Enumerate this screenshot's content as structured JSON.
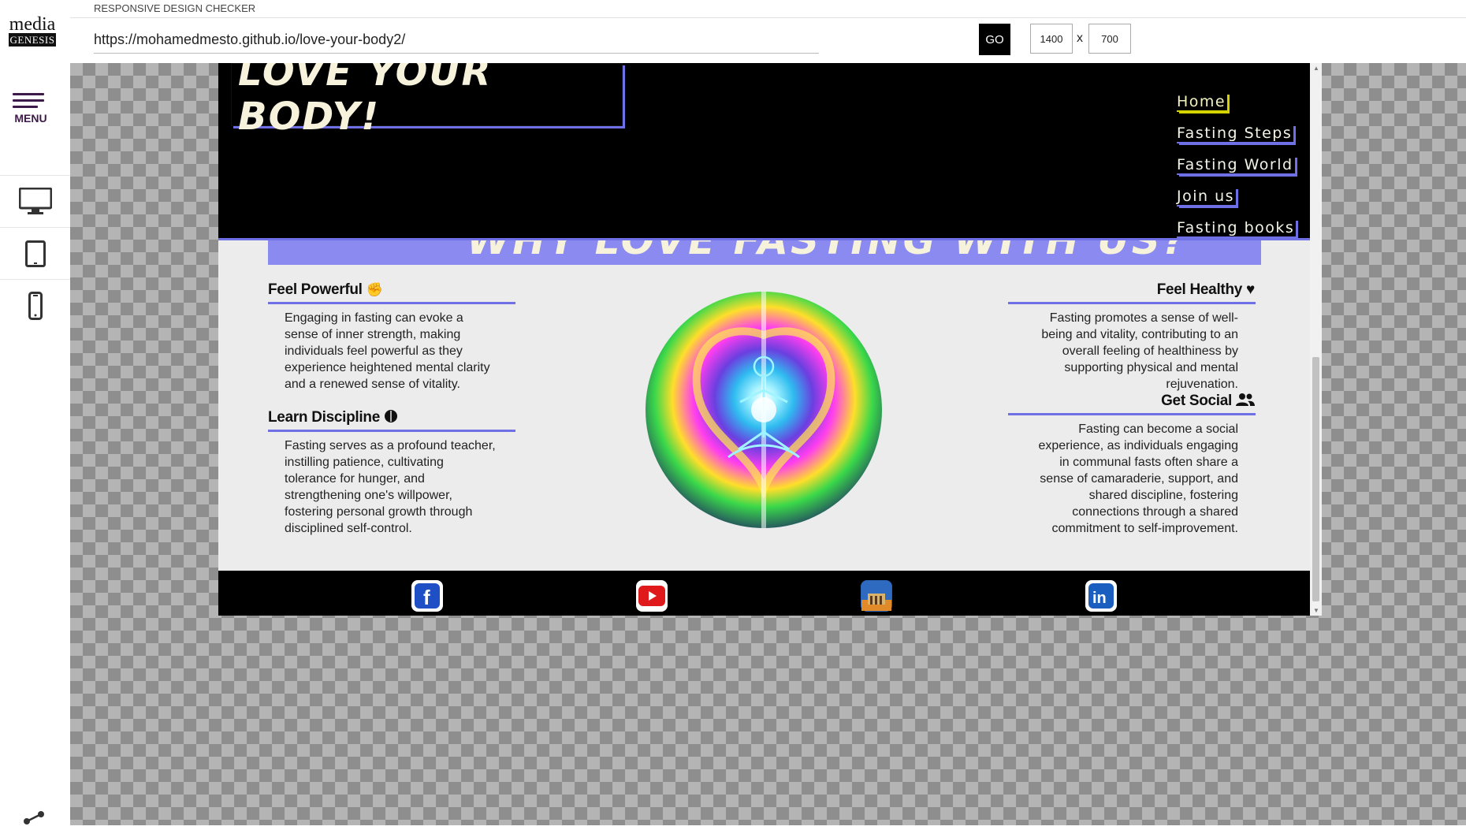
{
  "sidebar": {
    "logo_top": "media",
    "logo_bottom": "GENESIS",
    "menu_label": "MENU",
    "devices": [
      "desktop-icon",
      "tablet-icon",
      "phone-icon"
    ]
  },
  "toolbar": {
    "title": "RESPONSIVE DESIGN CHECKER",
    "url": "https://mohamedmesto.github.io/love-your-body2/",
    "go_label": "GO",
    "width": "1400",
    "height": "700",
    "separator": "x"
  },
  "site": {
    "title": "LOVE YOUR BODY!",
    "nav": [
      "Home",
      "Fasting Steps",
      "Fasting World",
      "Join us",
      "Fasting books"
    ],
    "banner": "WHY LOVE FASTING WITH US?",
    "features": {
      "powerful": {
        "title": "Feel Powerful",
        "text": "Engaging in fasting can evoke a sense of inner strength, making individuals feel powerful as they experience heightened mental clarity and a renewed sense of vitality."
      },
      "discipline": {
        "title": "Learn Discipline",
        "text": "Fasting serves as a profound teacher, instilling patience, cultivating tolerance for hunger, and strengthening one's willpower, fostering personal growth through disciplined self-control."
      },
      "healthy": {
        "title": "Feel Healthy",
        "text": "Fasting promotes a sense of well-being and vitality, contributing to an overall feeling of healthiness by supporting physical and mental rejuvenation."
      },
      "social": {
        "title": "Get Social",
        "text": "Fasting can become a social experience, as individuals engaging in communal fasts often share a sense of camaraderie, support, and shared discipline, fostering connections through a shared commitment to self-improvement."
      }
    },
    "social_icons": [
      "facebook-icon",
      "youtube-icon",
      "berlin-icon",
      "linkedin-icon"
    ]
  },
  "colors": {
    "accent": "#6f6fe6",
    "banner": "#8a8af0",
    "title_text": "#f7f2dc",
    "nav_active": "#d4d400",
    "sidebar_purple": "#3d1a4a"
  }
}
